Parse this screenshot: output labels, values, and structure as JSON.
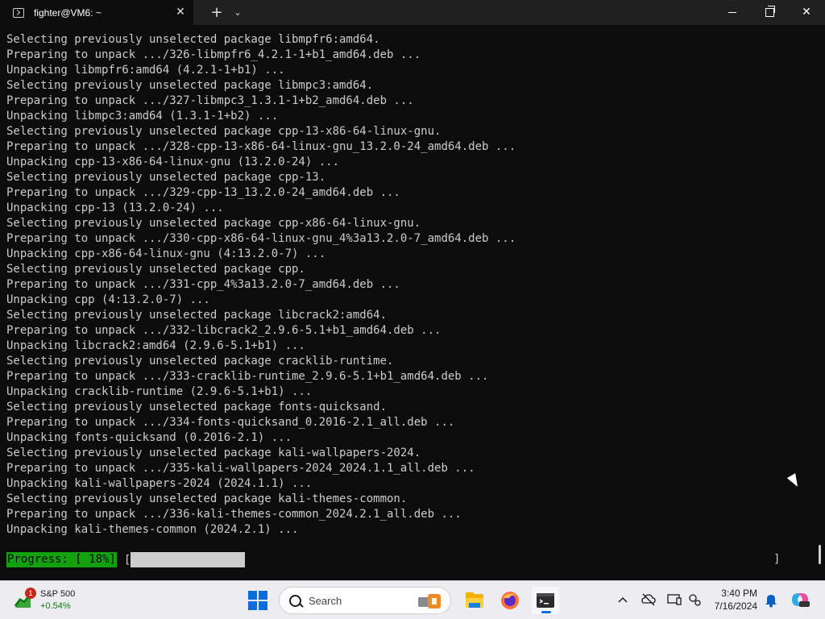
{
  "window": {
    "tab_title": "fighter@VM6: ~",
    "new_tab_glyph": "+",
    "dropdown_glyph": "⌄",
    "close_tab_glyph": "✕",
    "minimize_glyph": "",
    "close_glyph": "✕"
  },
  "terminal": {
    "lines": [
      "Selecting previously unselected package libmpfr6:amd64.",
      "Preparing to unpack .../326-libmpfr6_4.2.1-1+b1_amd64.deb ...",
      "Unpacking libmpfr6:amd64 (4.2.1-1+b1) ...",
      "Selecting previously unselected package libmpc3:amd64.",
      "Preparing to unpack .../327-libmpc3_1.3.1-1+b2_amd64.deb ...",
      "Unpacking libmpc3:amd64 (1.3.1-1+b2) ...",
      "Selecting previously unselected package cpp-13-x86-64-linux-gnu.",
      "Preparing to unpack .../328-cpp-13-x86-64-linux-gnu_13.2.0-24_amd64.deb ...",
      "Unpacking cpp-13-x86-64-linux-gnu (13.2.0-24) ...",
      "Selecting previously unselected package cpp-13.",
      "Preparing to unpack .../329-cpp-13_13.2.0-24_amd64.deb ...",
      "Unpacking cpp-13 (13.2.0-24) ...",
      "Selecting previously unselected package cpp-x86-64-linux-gnu.",
      "Preparing to unpack .../330-cpp-x86-64-linux-gnu_4%3a13.2.0-7_amd64.deb ...",
      "Unpacking cpp-x86-64-linux-gnu (4:13.2.0-7) ...",
      "Selecting previously unselected package cpp.",
      "Preparing to unpack .../331-cpp_4%3a13.2.0-7_amd64.deb ...",
      "Unpacking cpp (4:13.2.0-7) ...",
      "Selecting previously unselected package libcrack2:amd64.",
      "Preparing to unpack .../332-libcrack2_2.9.6-5.1+b1_amd64.deb ...",
      "Unpacking libcrack2:amd64 (2.9.6-5.1+b1) ...",
      "Selecting previously unselected package cracklib-runtime.",
      "Preparing to unpack .../333-cracklib-runtime_2.9.6-5.1+b1_amd64.deb ...",
      "Unpacking cracklib-runtime (2.9.6-5.1+b1) ...",
      "Selecting previously unselected package fonts-quicksand.",
      "Preparing to unpack .../334-fonts-quicksand_0.2016-2.1_all.deb ...",
      "Unpacking fonts-quicksand (0.2016-2.1) ...",
      "Selecting previously unselected package kali-wallpapers-2024.",
      "Preparing to unpack .../335-kali-wallpapers-2024_2024.1.1_all.deb ...",
      "Unpacking kali-wallpapers-2024 (2024.1.1) ...",
      "Selecting previously unselected package kali-themes-common.",
      "Preparing to unpack .../336-kali-themes-common_2024.2.1_all.deb ...",
      "Unpacking kali-themes-common (2024.2.1) ..."
    ],
    "progress": {
      "label": "Progress: [ 18%]",
      "open_bracket": "[",
      "close_bracket": "]",
      "fraction": 0.18
    }
  },
  "taskbar": {
    "widget": {
      "badge": "1",
      "name": "S&P 500",
      "change": "+0.54%"
    },
    "search_placeholder": "Search",
    "clock": {
      "time": "3:40 PM",
      "date": "7/16/2024"
    },
    "icons": [
      "start-icon",
      "search-icon",
      "file-explorer-icon",
      "firefox-icon",
      "terminal-icon",
      "chevron-up-icon",
      "cloud-off-icon",
      "screen-icon",
      "settings-icon",
      "notification-bell-icon",
      "copilot-icon"
    ]
  }
}
